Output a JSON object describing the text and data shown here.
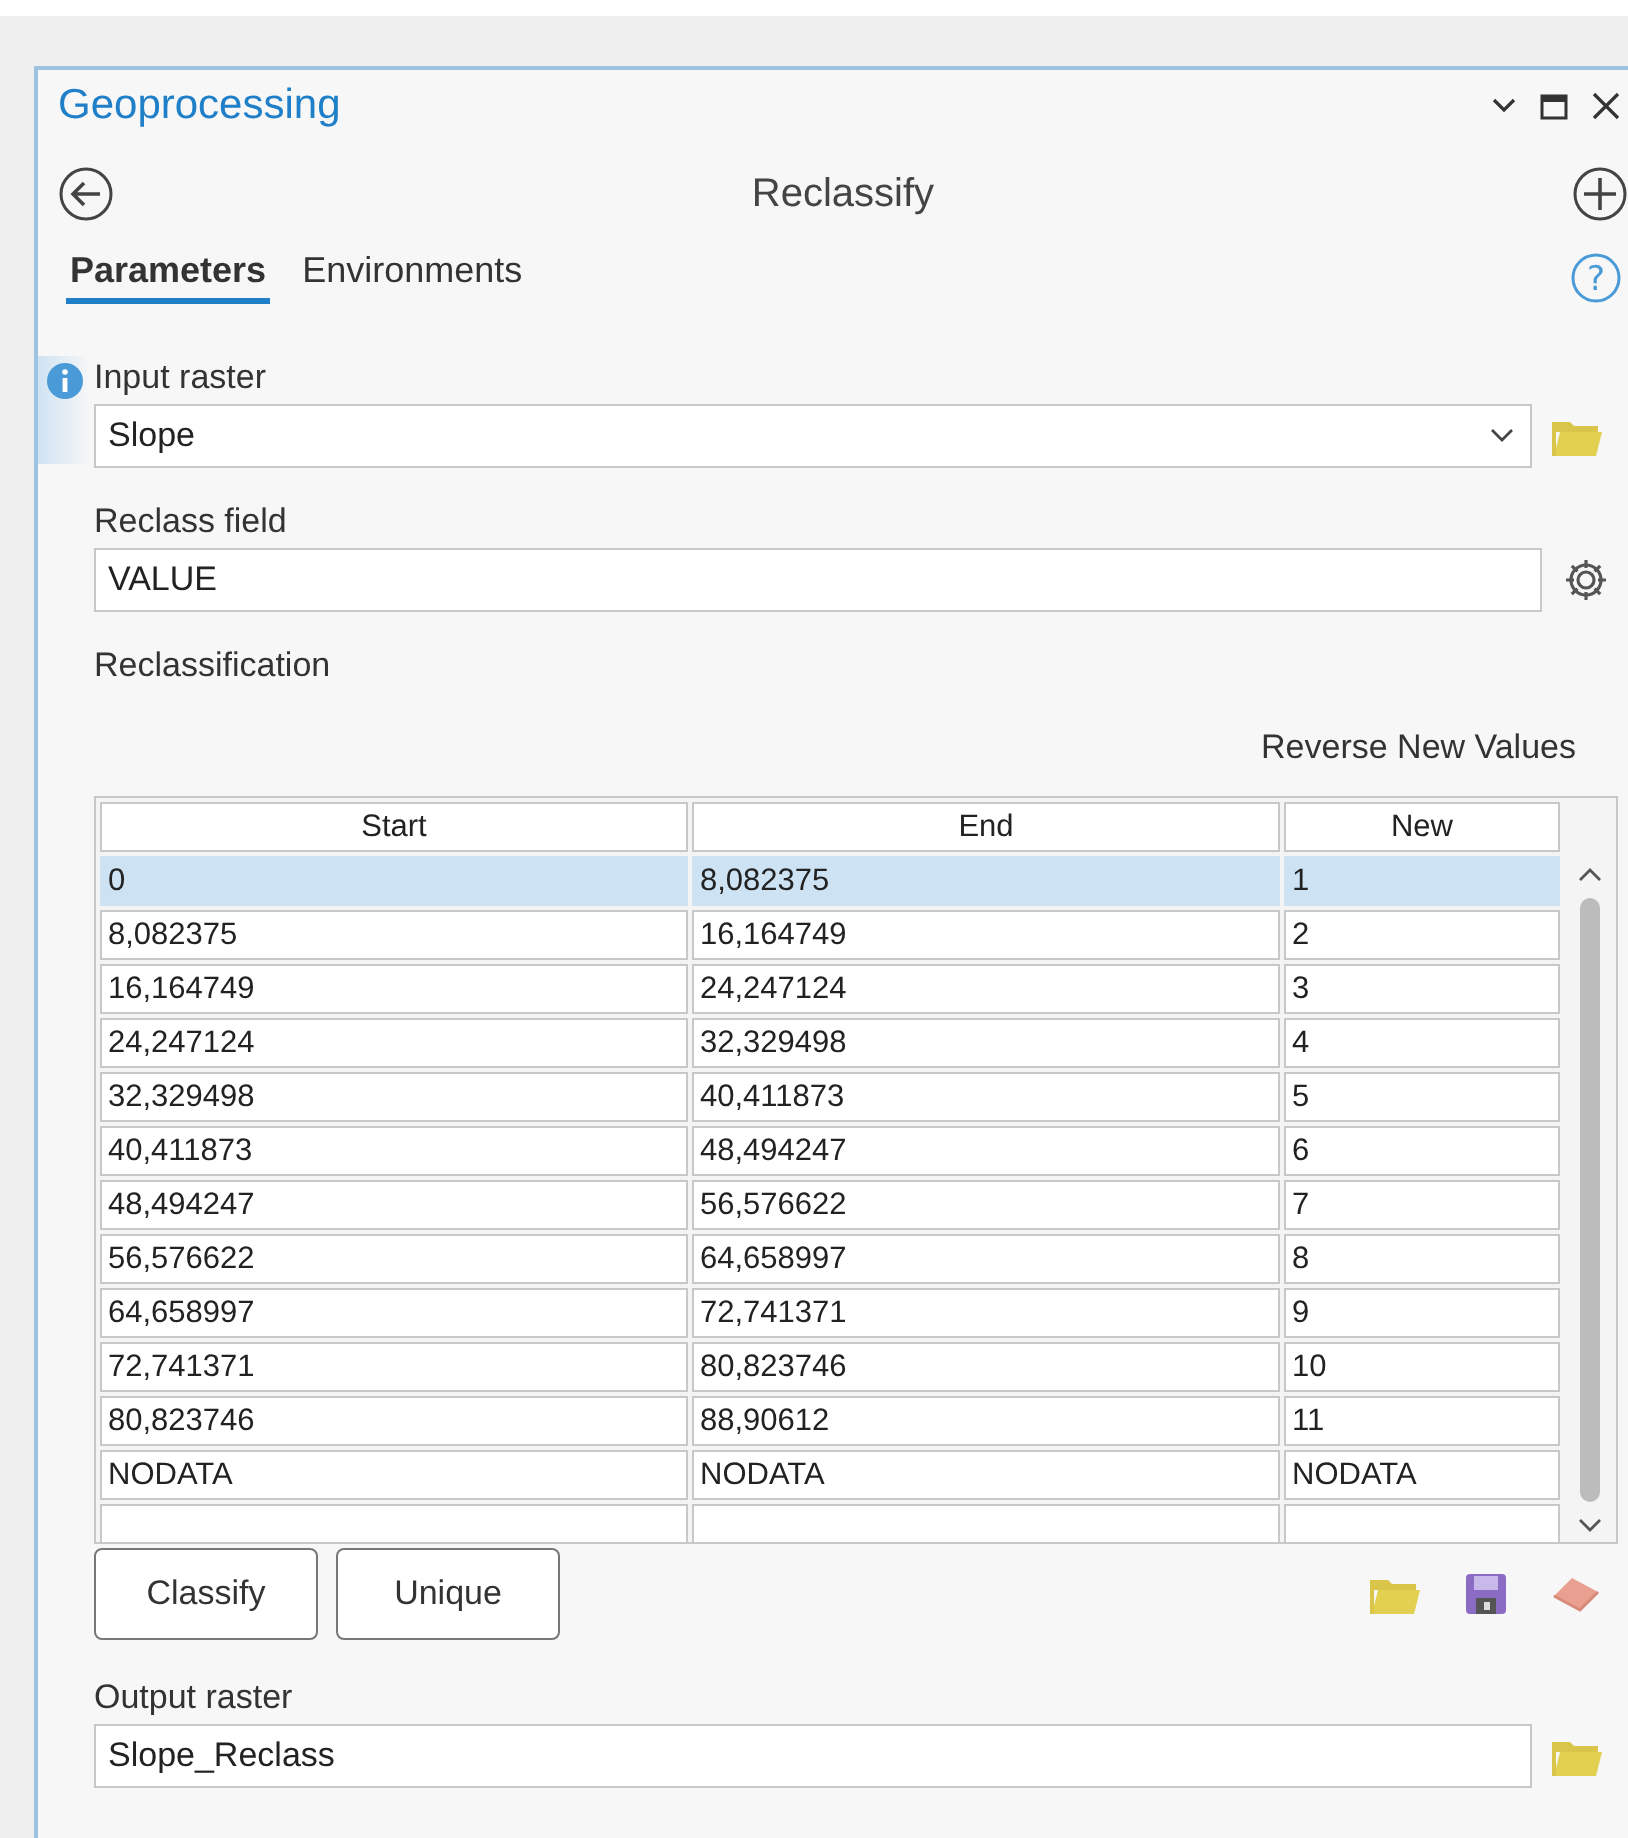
{
  "window": {
    "title": "Geoprocessing"
  },
  "tool": {
    "title": "Reclassify"
  },
  "help": {
    "icon": "?"
  },
  "tabs": [
    {
      "label": "Parameters",
      "selected": true
    },
    {
      "label": "Environments",
      "selected": false
    }
  ],
  "input_raster": {
    "label": "Input raster",
    "value": "Slope"
  },
  "reclass_field": {
    "label": "Reclass field",
    "value": "VALUE"
  },
  "reclassification": {
    "label": "Reclassification",
    "reverse_link": "Reverse New Values",
    "columns": [
      "Start",
      "End",
      "New"
    ],
    "rows": [
      {
        "start": "0",
        "end": "8,082375",
        "new": "1",
        "selected": true
      },
      {
        "start": "8,082375",
        "end": "16,164749",
        "new": "2",
        "selected": false
      },
      {
        "start": "16,164749",
        "end": "24,247124",
        "new": "3",
        "selected": false
      },
      {
        "start": "24,247124",
        "end": "32,329498",
        "new": "4",
        "selected": false
      },
      {
        "start": "32,329498",
        "end": "40,411873",
        "new": "5",
        "selected": false
      },
      {
        "start": "40,411873",
        "end": "48,494247",
        "new": "6",
        "selected": false
      },
      {
        "start": "48,494247",
        "end": "56,576622",
        "new": "7",
        "selected": false
      },
      {
        "start": "56,576622",
        "end": "64,658997",
        "new": "8",
        "selected": false
      },
      {
        "start": "64,658997",
        "end": "72,741371",
        "new": "9",
        "selected": false
      },
      {
        "start": "72,741371",
        "end": "80,823746",
        "new": "10",
        "selected": false
      },
      {
        "start": "80,823746",
        "end": "88,90612",
        "new": "11",
        "selected": false
      },
      {
        "start": "NODATA",
        "end": "NODATA",
        "new": "NODATA",
        "selected": false
      }
    ],
    "buttons": [
      "Classify",
      "Unique"
    ]
  },
  "output_raster": {
    "label": "Output raster",
    "value": "Slope_Reclass"
  }
}
